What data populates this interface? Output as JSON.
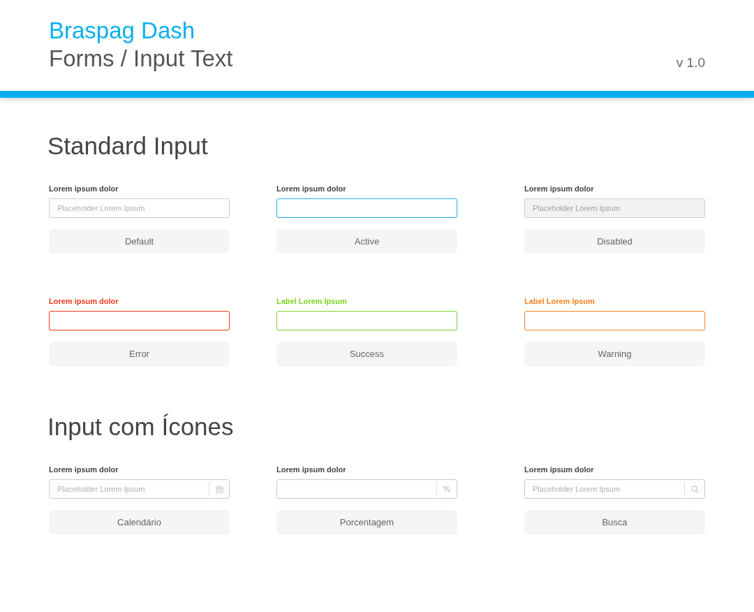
{
  "header": {
    "brand": "Braspag Dash",
    "title": "Forms / Input Text",
    "version": "v 1.0"
  },
  "sections": [
    {
      "title": "Standard Input",
      "fields": [
        {
          "label": "Lorem ipsum dolor",
          "kind": "default",
          "placeholder": "Placeholder Lorem Ipsum",
          "caption": "Default"
        },
        {
          "label": "Lorem ipsum dolor",
          "kind": "active",
          "caption": "Active"
        },
        {
          "label": "Lorem ipsum dolor",
          "kind": "disabled",
          "placeholder": "Placeholder Lorem Ipsum",
          "caption": "Disabled"
        },
        {
          "label": "Lorem ipsum dolor",
          "kind": "error",
          "caption": "Error"
        },
        {
          "label": "Label Lorem Ipsum",
          "kind": "success",
          "caption": "Success"
        },
        {
          "label": "Label Lorem Ipsum",
          "kind": "warning",
          "caption": "Warning"
        }
      ]
    },
    {
      "title": "Input com Ícones",
      "fields": [
        {
          "label": "Lorem ipsum dolor",
          "kind": "default",
          "placeholder": "Placeholder Lorem Ipsum",
          "addon": {
            "kind": "calendar"
          },
          "caption": "Calendário"
        },
        {
          "label": "Lorem ipsum dolor",
          "kind": "default",
          "addon": {
            "kind": "text",
            "text": "%"
          },
          "caption": "Porcentagem"
        },
        {
          "label": "Lorem ipsum dolor",
          "kind": "default",
          "placeholder": "Placeholder Lorem Ipsum",
          "addon": {
            "kind": "search"
          },
          "caption": "Busca"
        }
      ]
    }
  ]
}
